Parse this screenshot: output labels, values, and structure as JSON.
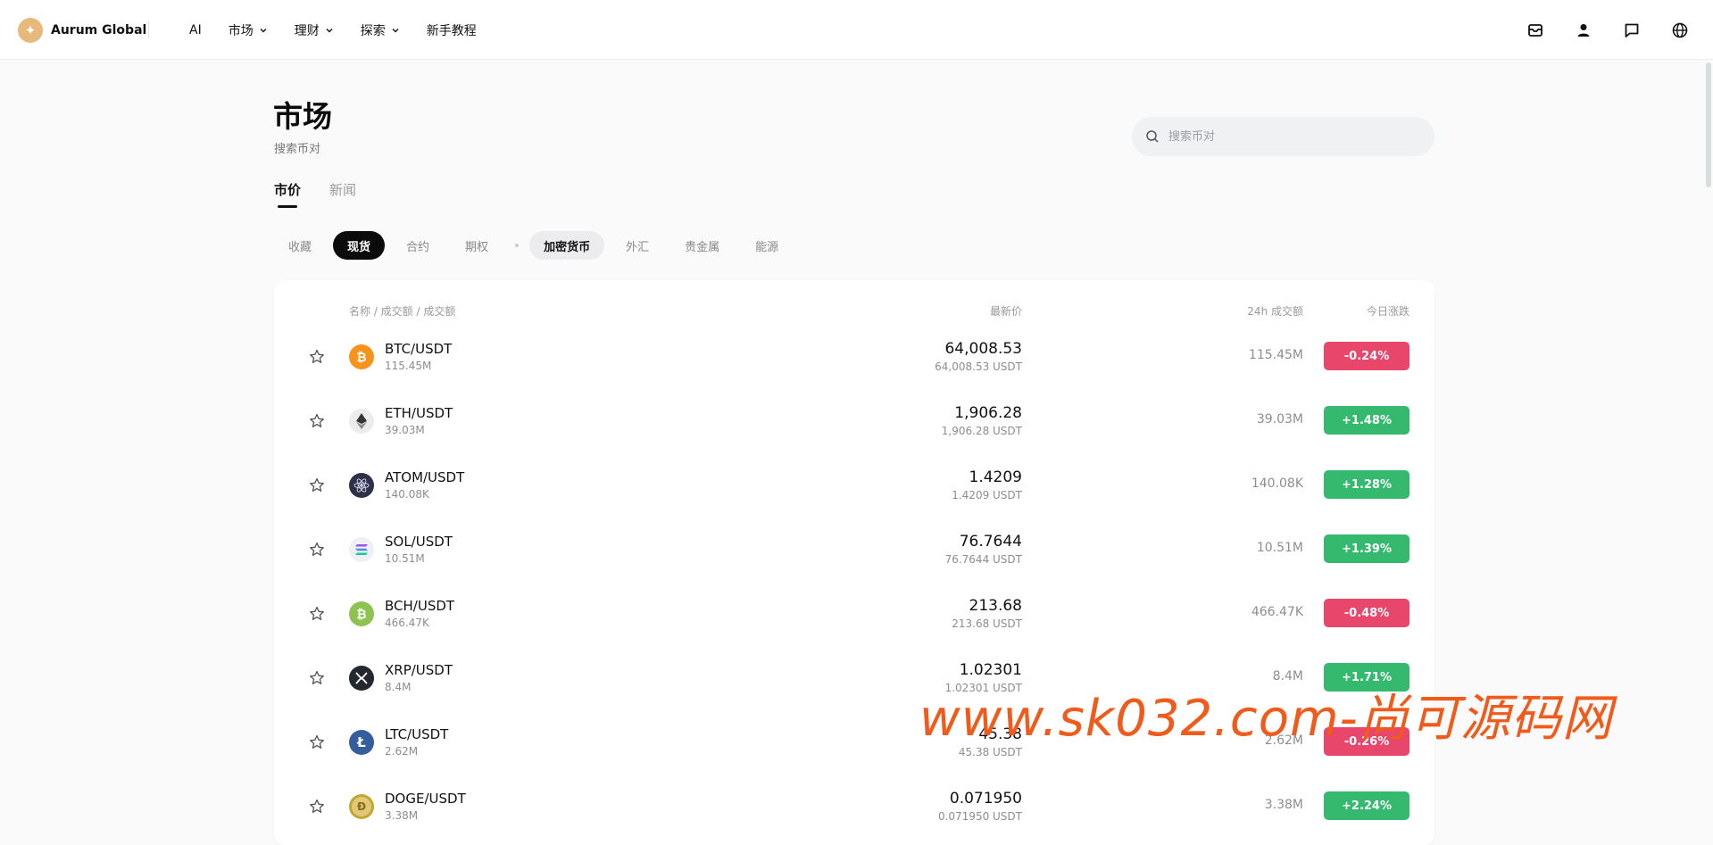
{
  "brand": {
    "name": "Aurum Global"
  },
  "nav": [
    {
      "label": "AI",
      "dropdown": false
    },
    {
      "label": "市场",
      "dropdown": true
    },
    {
      "label": "理财",
      "dropdown": true
    },
    {
      "label": "探索",
      "dropdown": true
    },
    {
      "label": "新手教程",
      "dropdown": false
    }
  ],
  "top_icons": [
    "inbox-icon",
    "user-icon",
    "chat-icon",
    "globe-icon"
  ],
  "page": {
    "title": "市场",
    "subtitle": "搜索币对"
  },
  "search": {
    "placeholder": "搜索币对",
    "value": ""
  },
  "tabs": [
    {
      "label": "市价",
      "active": true
    },
    {
      "label": "新闻",
      "active": false
    }
  ],
  "filters": {
    "primary": [
      {
        "label": "收藏",
        "active": false
      },
      {
        "label": "现货",
        "active": true
      },
      {
        "label": "合约",
        "active": false
      },
      {
        "label": "期权",
        "active": false
      }
    ],
    "secondary": [
      {
        "label": "加密货币",
        "active": true
      },
      {
        "label": "外汇",
        "active": false
      },
      {
        "label": "贵金属",
        "active": false
      },
      {
        "label": "能源",
        "active": false
      }
    ]
  },
  "table": {
    "headers": {
      "name": "名称 / 成交额 / 成交额",
      "price": "最新价",
      "volume": "24h 成交额",
      "change": "今日涨跌"
    },
    "rows": [
      {
        "pair": "BTC/USDT",
        "sub_volume": "115.45M",
        "price": "64,008.53",
        "price_usdt": "64,008.53 USDT",
        "volume": "115.45M",
        "change": "-0.24%",
        "direction": "down",
        "icon": "btc-icon",
        "icon_color": "#f7931a"
      },
      {
        "pair": "ETH/USDT",
        "sub_volume": "39.03M",
        "price": "1,906.28",
        "price_usdt": "1,906.28 USDT",
        "volume": "39.03M",
        "change": "+1.48%",
        "direction": "up",
        "icon": "eth-icon",
        "icon_color": "#ececec"
      },
      {
        "pair": "ATOM/USDT",
        "sub_volume": "140.08K",
        "price": "1.4209",
        "price_usdt": "1.4209 USDT",
        "volume": "140.08K",
        "change": "+1.28%",
        "direction": "up",
        "icon": "atom-icon",
        "icon_color": "#2e3148"
      },
      {
        "pair": "SOL/USDT",
        "sub_volume": "10.51M",
        "price": "76.7644",
        "price_usdt": "76.7644 USDT",
        "volume": "10.51M",
        "change": "+1.39%",
        "direction": "up",
        "icon": "sol-icon",
        "icon_color": "#eef0f5"
      },
      {
        "pair": "BCH/USDT",
        "sub_volume": "466.47K",
        "price": "213.68",
        "price_usdt": "213.68 USDT",
        "volume": "466.47K",
        "change": "-0.48%",
        "direction": "down",
        "icon": "bch-icon",
        "icon_color": "#8dc351"
      },
      {
        "pair": "XRP/USDT",
        "sub_volume": "8.4M",
        "price": "1.02301",
        "price_usdt": "1.02301 USDT",
        "volume": "8.4M",
        "change": "+1.71%",
        "direction": "up",
        "icon": "xrp-icon",
        "icon_color": "#23292f"
      },
      {
        "pair": "LTC/USDT",
        "sub_volume": "2.62M",
        "price": "45.38",
        "price_usdt": "45.38 USDT",
        "volume": "2.62M",
        "change": "-0.26%",
        "direction": "down",
        "icon": "ltc-icon",
        "icon_color": "#345d9d"
      },
      {
        "pair": "DOGE/USDT",
        "sub_volume": "3.38M",
        "price": "0.071950",
        "price_usdt": "0.071950 USDT",
        "volume": "3.38M",
        "change": "+2.24%",
        "direction": "up",
        "icon": "doge-icon",
        "icon_color": "#c2a633"
      }
    ]
  },
  "colors": {
    "up": "#34b96f",
    "down": "#e8466b",
    "accent": "#e7b97a"
  },
  "watermark": {
    "text": "www.sk032.com-尚可源码网"
  }
}
